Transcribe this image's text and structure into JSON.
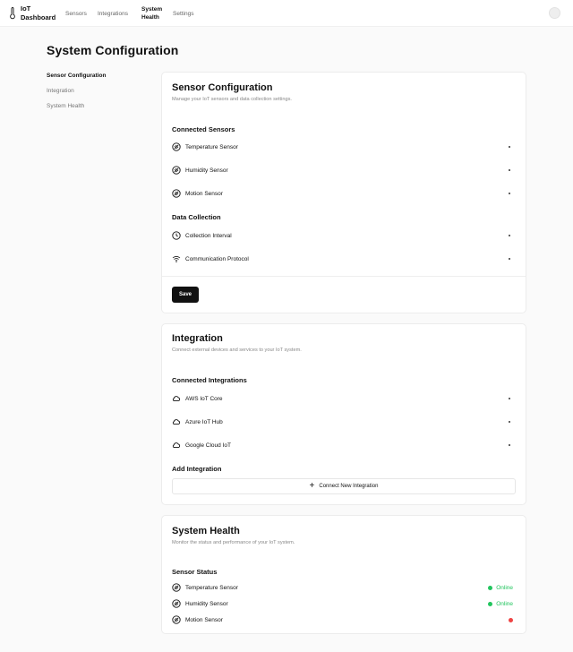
{
  "app": {
    "title": "IoT Dashboard",
    "nav": [
      {
        "label": "Sensors"
      },
      {
        "label": "Integrations"
      },
      {
        "label": "System Health",
        "active": true
      },
      {
        "label": "Settings"
      }
    ]
  },
  "page": {
    "title": "System Configuration",
    "side_nav": [
      {
        "label": "Sensor Configuration",
        "active": true
      },
      {
        "label": "Integration"
      },
      {
        "label": "System Health"
      }
    ]
  },
  "sensor_config": {
    "title": "Sensor Configuration",
    "description": "Manage your IoT sensors and data collection settings.",
    "connected_title": "Connected Sensors",
    "sensors": [
      {
        "label": "Temperature Sensor",
        "icon": "sensor-icon"
      },
      {
        "label": "Humidity Sensor",
        "icon": "sensor-icon"
      },
      {
        "label": "Motion Sensor",
        "icon": "sensor-icon"
      }
    ],
    "data_collection_title": "Data Collection",
    "data_collection": [
      {
        "label": "Collection Interval",
        "icon": "clock-icon"
      },
      {
        "label": "Communication Protocol",
        "icon": "wifi-icon"
      }
    ],
    "save_label": "Save"
  },
  "integration": {
    "title": "Integration",
    "description": "Connect external devices and services to your IoT system.",
    "connected_title": "Connected Integrations",
    "items": [
      {
        "label": "AWS IoT Core",
        "icon": "cloud-icon"
      },
      {
        "label": "Azure IoT Hub",
        "icon": "cloud-icon"
      },
      {
        "label": "Google Cloud IoT",
        "icon": "cloud-icon"
      }
    ],
    "add_title": "Add Integration",
    "connect_label": "Connect New Integration"
  },
  "system_health": {
    "title": "System Health",
    "description": "Monitor the status and performance of your IoT system.",
    "status_title": "Sensor Status",
    "sensors": [
      {
        "label": "Temperature Sensor",
        "status": "Online",
        "color": "#22c55e"
      },
      {
        "label": "Humidity Sensor",
        "status": "Online",
        "color": "#22c55e"
      },
      {
        "label": "Motion Sensor",
        "status": "",
        "color": "#ef4444"
      }
    ]
  }
}
